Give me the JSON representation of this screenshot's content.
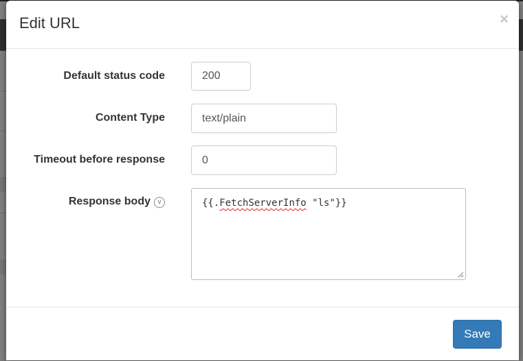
{
  "modal": {
    "title": "Edit URL",
    "close_glyph": "×"
  },
  "form": {
    "status_code": {
      "label": "Default status code",
      "value": "200"
    },
    "content_type": {
      "label": "Content Type",
      "value": "text/plain"
    },
    "timeout": {
      "label": "Timeout before response",
      "value": "0"
    },
    "response_body": {
      "label": "Response body",
      "info_icon_glyph": "v",
      "value_prefix": "{{.",
      "value_misspelled": "FetchServerInfo",
      "value_suffix": " \"ls\"}}"
    }
  },
  "footer": {
    "save_label": "Save"
  },
  "colors": {
    "primary_button": "#337ab7",
    "backdrop": "#808080"
  }
}
